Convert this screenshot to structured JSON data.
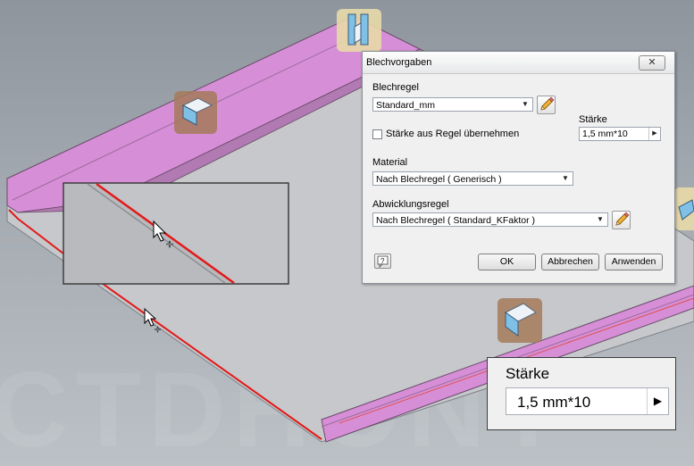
{
  "dialog": {
    "title": "Blechvorgaben",
    "close_label": "✕",
    "blechregel_label": "Blechregel",
    "blechregel_value": "Standard_mm",
    "staerke_label": "Stärke",
    "staerke_value": "1,5 mm*10",
    "checkbox_label": "Stärke aus Regel übernehmen",
    "checkbox_checked": false,
    "material_label": "Material",
    "material_value": "Nach Blechregel ( Generisch )",
    "abwicklung_label": "Abwicklungsregel",
    "abwicklung_value": "Nach Blechregel ( Standard_KFaktor )",
    "ok_label": "OK",
    "abbrechen_label": "Abbrechen",
    "anwenden_label": "Anwenden"
  },
  "zoom_callout": {
    "label": "Stärke",
    "value": "1,5 mm*10"
  },
  "icons": {
    "pencil": "pencil-icon",
    "help": "help-icon",
    "flange_tool": "flange-tool-icon",
    "cursor": "cursor-crosshair-icon"
  },
  "colors": {
    "flange_magenta": "#d68fd6",
    "highlight_red": "#e21a1a",
    "plate_gray": "#c6c8cb",
    "tool_badge": "#a47a5a"
  },
  "watermark": "CTDHONY"
}
